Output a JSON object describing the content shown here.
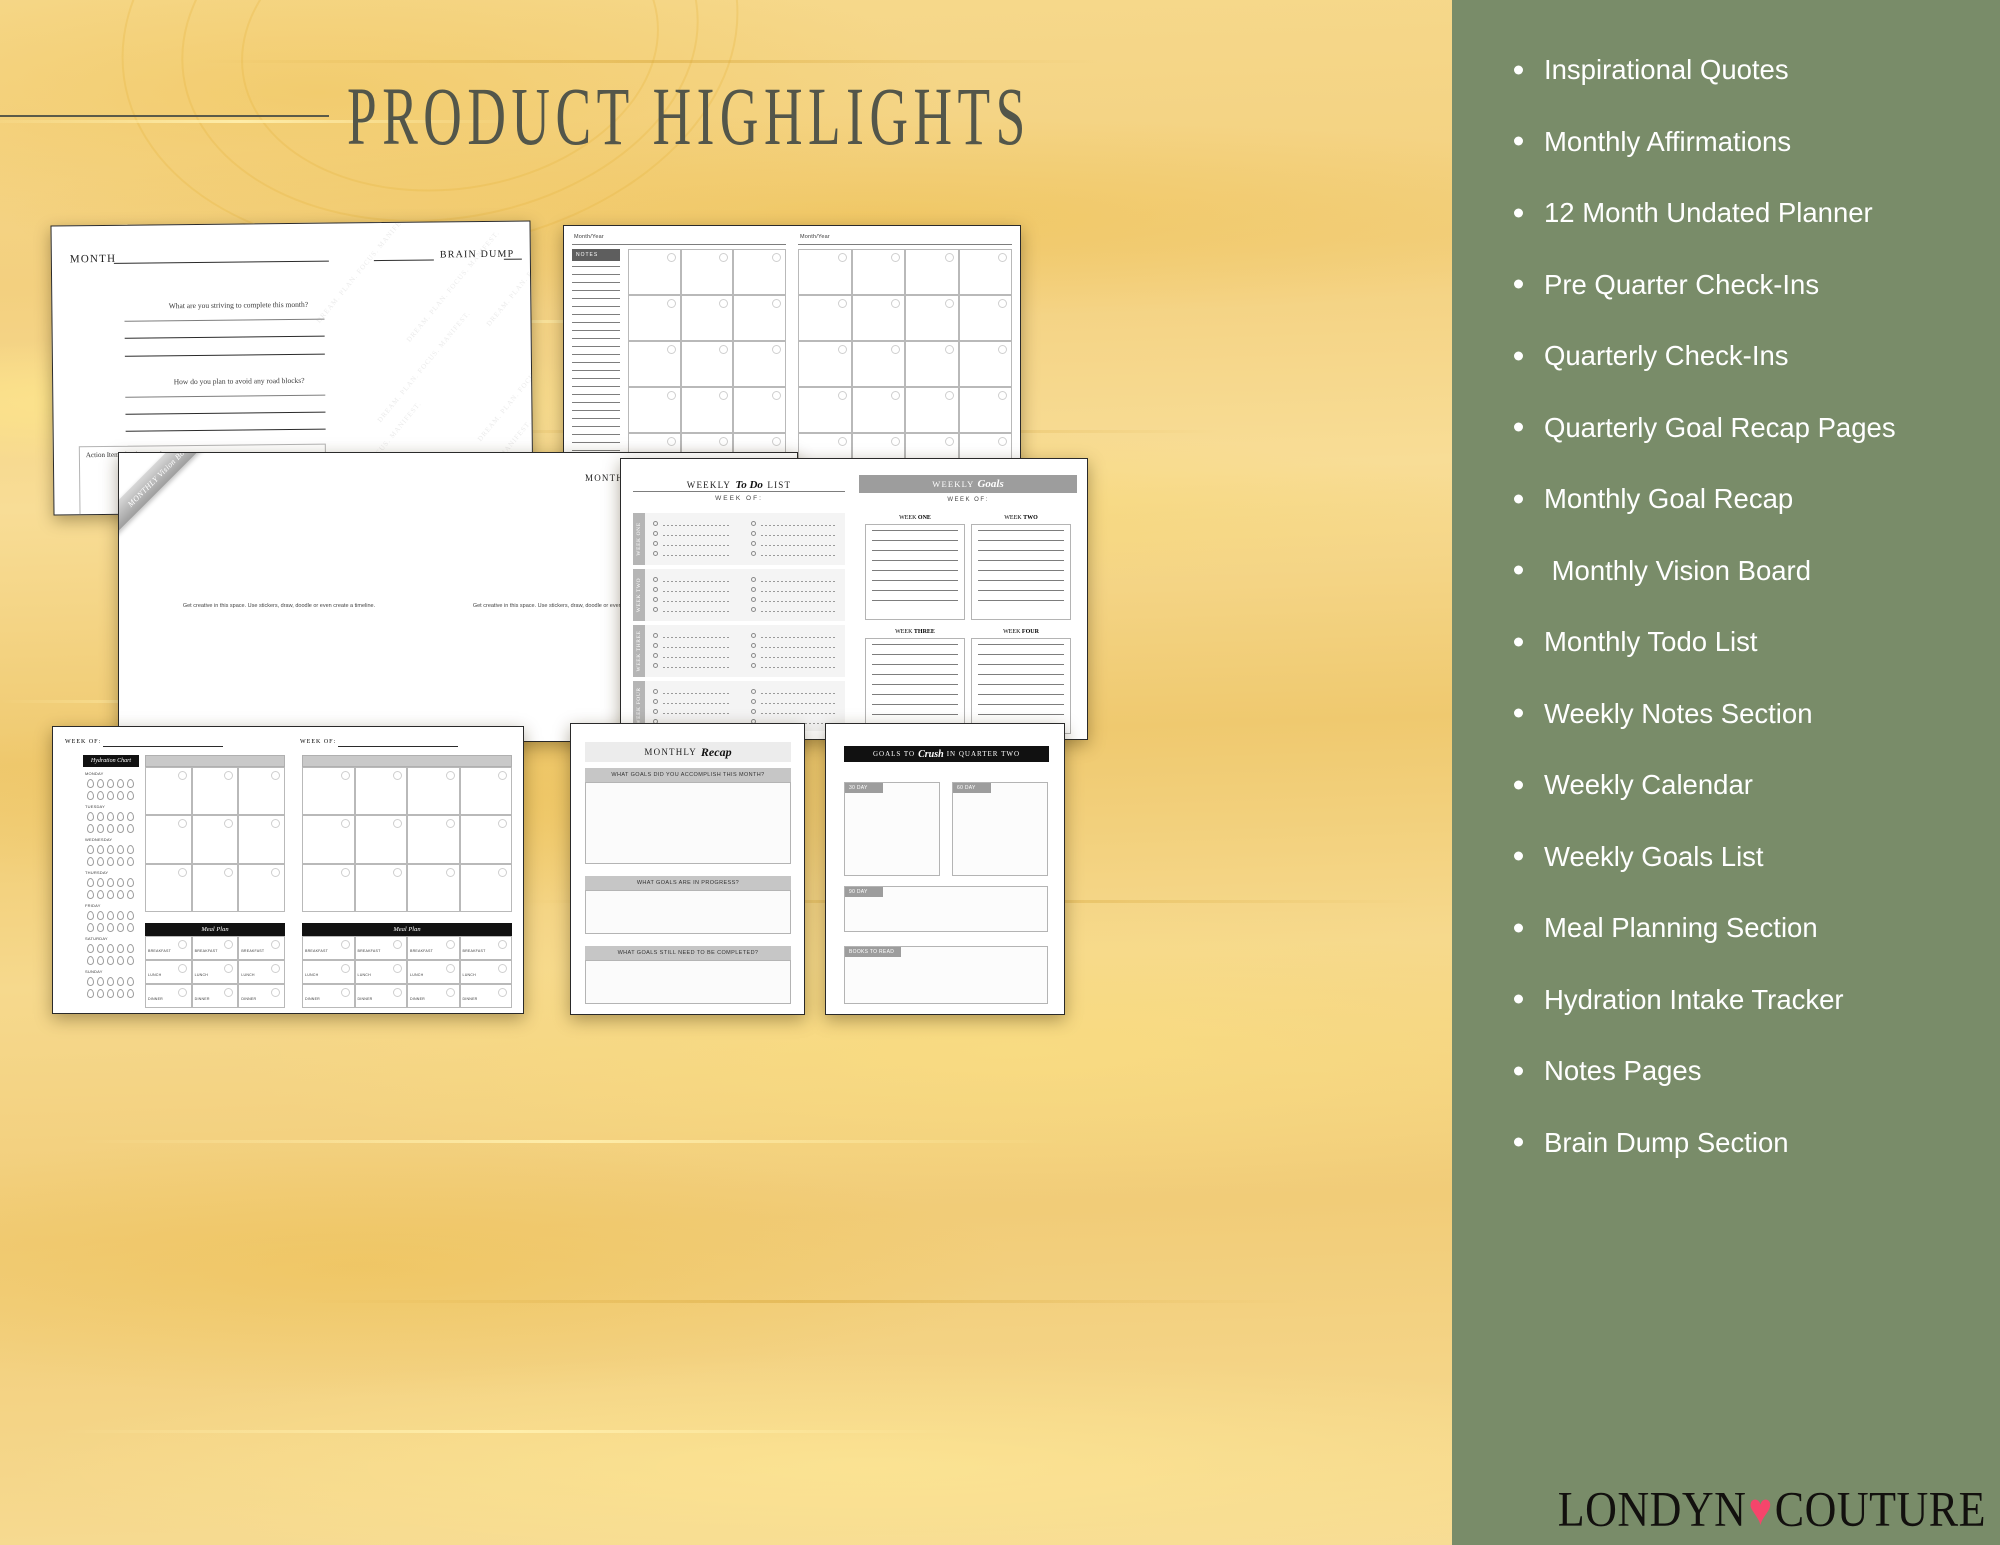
{
  "header": {
    "title": "PRODUCT HIGHLIGHTS"
  },
  "colors": {
    "background_yellow": "#f3d07f",
    "sidebar_green": "#798c69",
    "title_text": "#53564a",
    "bullet_text": "#ffffff",
    "heart_pink": "#f5456b"
  },
  "sidebar": {
    "items": [
      {
        "label": "Inspirational Quotes"
      },
      {
        "label": "Monthly Affirmations"
      },
      {
        "label": "12 Month Undated Planner"
      },
      {
        "label": "Pre Quarter Check-Ins"
      },
      {
        "label": "Quarterly Check-Ins"
      },
      {
        "label": "Quarterly Goal Recap Pages"
      },
      {
        "label": "Monthly Goal Recap"
      },
      {
        "label": " Monthly Vision Board"
      },
      {
        "label": "Monthly Todo List"
      },
      {
        "label": "Weekly Notes Section"
      },
      {
        "label": "Weekly Calendar"
      },
      {
        "label": "Weekly Goals List"
      },
      {
        "label": "Meal Planning Section"
      },
      {
        "label": "Hydration Intake Tracker"
      },
      {
        "label": "Notes Pages"
      },
      {
        "label": "Brain Dump Section"
      }
    ]
  },
  "logo": {
    "word_one": "LONDYN",
    "heart": "♥",
    "word_two": "COUTURE"
  },
  "mockups": {
    "month_brain_dump": {
      "month_label": "MONTH",
      "brain_dump_label": "BRAIN DUMP",
      "prompt_one": "What are you striving to complete this month?",
      "prompt_two": "How do you plan to avoid any road blocks?",
      "action_items_label": "Action Items for this month",
      "watermark": "DREAM. PLAN. FOCUS. MANIFEST."
    },
    "monthly_calendar": {
      "month_year_label": "Month/Year",
      "notes_label": "NOTES"
    },
    "vision_board": {
      "month_label": "MONTH",
      "ribbon_top": "MONTHLY Vision Board",
      "ribbon_bottom": "MONTHLY Vision Board",
      "caption_left": "Get creative in this space. Use stickers, draw, doodle or even create a timeline.",
      "caption_right": "Get creative in this space. Use stickers, draw, doodle or even create a timeline."
    },
    "weekly_todo": {
      "title_pre": "WEEKLY",
      "title_script": "To Do",
      "title_post": "LIST",
      "week_of_label": "WEEK OF:",
      "week_tabs": [
        "WEEK ONE",
        "WEEK TWO",
        "WEEK THREE",
        "WEEK FOUR"
      ]
    },
    "weekly_goals": {
      "title_pre": "WEEKLY",
      "title_script": "Goals",
      "week_of_label": "WEEK OF:",
      "cards": [
        {
          "prefix": "WEEK",
          "name": "ONE"
        },
        {
          "prefix": "WEEK",
          "name": "TWO"
        },
        {
          "prefix": "WEEK",
          "name": "THREE"
        },
        {
          "prefix": "WEEK",
          "name": "FOUR"
        }
      ]
    },
    "weekly_spread": {
      "week_of_label": "WEEK OF:",
      "hydration_title": "Hydration Chart",
      "days": [
        "MONDAY",
        "TUESDAY",
        "WEDNESDAY",
        "THURSDAY",
        "FRIDAY",
        "SATURDAY",
        "SUNDAY"
      ],
      "meal_plan_title": "Meal Plan",
      "meal_rows": [
        "BREAKFAST",
        "LUNCH",
        "DINNER"
      ]
    },
    "monthly_recap": {
      "title_pre": "MONTHLY",
      "title_script": "Recap",
      "section_one": "WHAT GOALS DID YOU ACCOMPLISH THIS MONTH?",
      "section_two": "WHAT GOALS ARE IN PROGRESS?",
      "section_three": "WHAT GOALS STILL NEED TO BE COMPLETED?"
    },
    "goals_to_crush": {
      "title_pre": "GOALS TO",
      "title_script": "Crush",
      "title_post": "IN QUARTER TWO",
      "boxes": [
        "30 DAY",
        "60 DAY",
        "90 DAY",
        "BOOKS TO READ"
      ]
    }
  }
}
